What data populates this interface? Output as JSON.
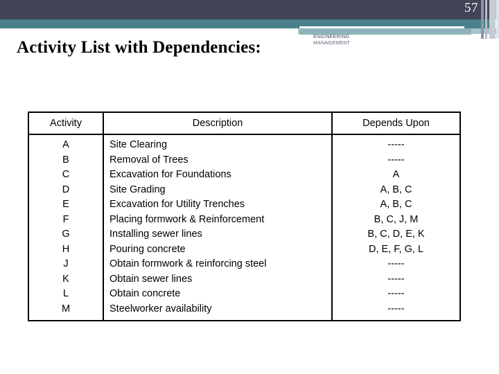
{
  "page": {
    "number": "57",
    "title": "Activity List with Dependencies:"
  },
  "logo": {
    "line1": "ENGINEERING",
    "line2": "MANAGEMENT"
  },
  "colors": {
    "header_navy": "#414356",
    "header_teal": "#49808a",
    "header_pale": "#a6c4ca",
    "text": "#000000",
    "page_number": "#ffffff"
  },
  "table": {
    "headers": [
      "Activity",
      "Description",
      "Depends Upon"
    ],
    "rows": [
      {
        "activity": "A",
        "description": "Site Clearing",
        "depends": "-----"
      },
      {
        "activity": "B",
        "description": "Removal of Trees",
        "depends": "-----"
      },
      {
        "activity": "C",
        "description": "Excavation for Foundations",
        "depends": "A"
      },
      {
        "activity": "D",
        "description": "Site Grading",
        "depends": "A, B, C"
      },
      {
        "activity": "E",
        "description": "Excavation for Utility Trenches",
        "depends": "A, B, C"
      },
      {
        "activity": "F",
        "description": "Placing formwork & Reinforcement",
        "depends": "B, C, J, M"
      },
      {
        "activity": "G",
        "description": "Installing sewer lines",
        "depends": "B, C, D, E, K"
      },
      {
        "activity": "H",
        "description": "Pouring concrete",
        "depends": "D, E, F, G, L"
      },
      {
        "activity": "J",
        "description": "Obtain formwork & reinforcing steel",
        "depends": "-----"
      },
      {
        "activity": "K",
        "description": "Obtain sewer lines",
        "depends": "-----"
      },
      {
        "activity": "L",
        "description": "Obtain concrete",
        "depends": "-----"
      },
      {
        "activity": "M",
        "description": "Steelworker availability",
        "depends": "-----"
      }
    ]
  }
}
